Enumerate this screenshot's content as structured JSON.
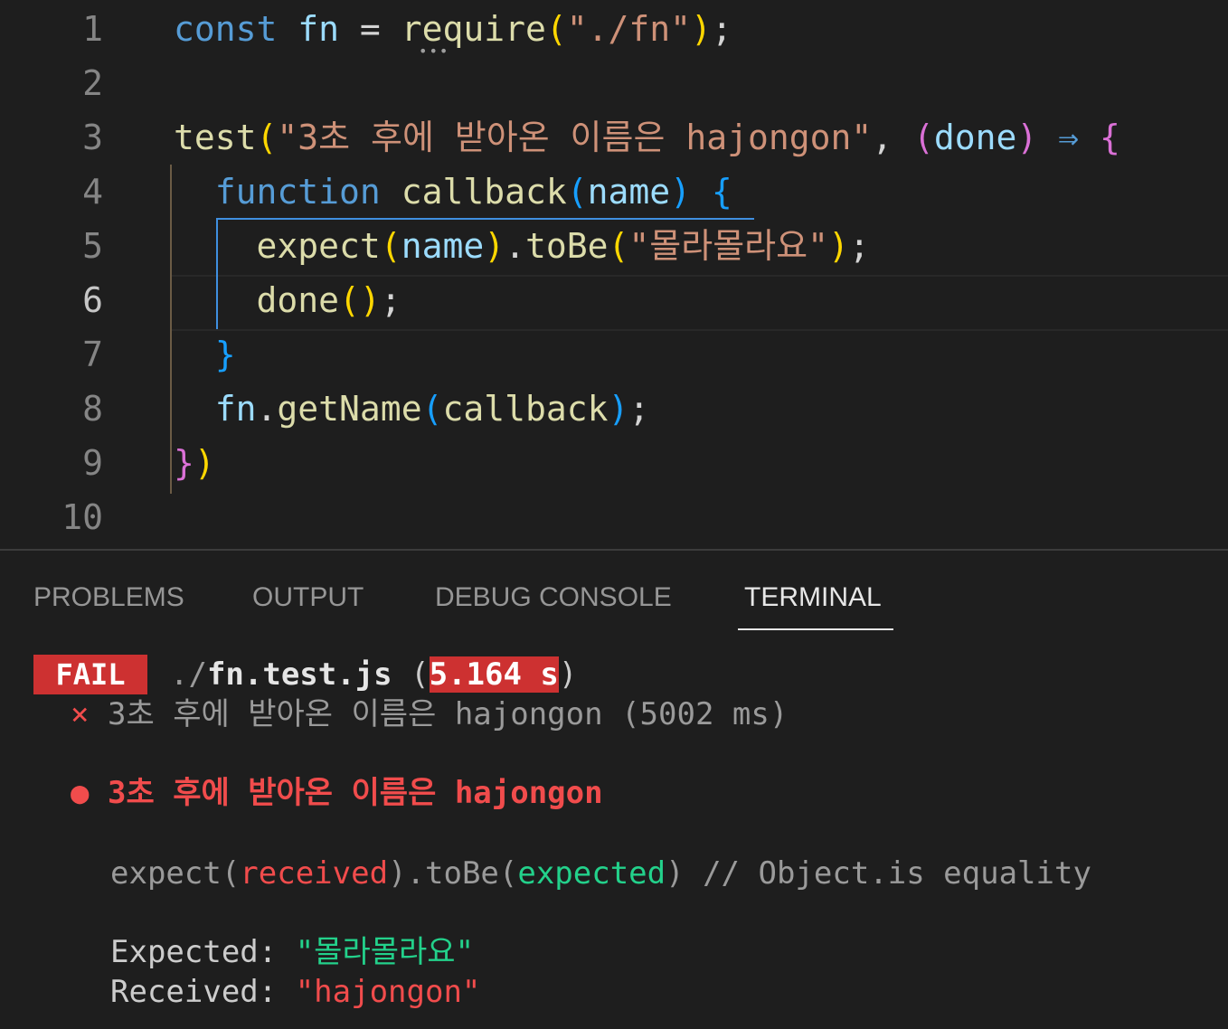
{
  "editor": {
    "active_line": "6",
    "lines": [
      {
        "num": "1",
        "tokens": [
          [
            "kw",
            "const"
          ],
          [
            "op",
            " "
          ],
          [
            "var",
            "fn"
          ],
          [
            "op",
            " = "
          ],
          [
            "fn",
            "require"
          ],
          [
            "p1",
            "("
          ],
          [
            "str",
            "\"./fn\""
          ],
          [
            "p1",
            ")"
          ],
          [
            "op",
            ";"
          ]
        ]
      },
      {
        "num": "2",
        "tokens": []
      },
      {
        "num": "3",
        "tokens": [
          [
            "fn",
            "test"
          ],
          [
            "p1",
            "("
          ],
          [
            "str",
            "\"3초 후에 받아온 이름은 hajongon\""
          ],
          [
            "op",
            ", "
          ],
          [
            "p2",
            "("
          ],
          [
            "var",
            "done"
          ],
          [
            "p2",
            ")"
          ],
          [
            "op",
            " "
          ],
          [
            "kw",
            "⇒"
          ],
          [
            "op",
            " "
          ],
          [
            "p2",
            "{"
          ]
        ]
      },
      {
        "num": "4",
        "tokens": [
          [
            "op",
            "  "
          ],
          [
            "kw",
            "function"
          ],
          [
            "op",
            " "
          ],
          [
            "fn",
            "callback"
          ],
          [
            "p3",
            "("
          ],
          [
            "var",
            "name"
          ],
          [
            "p3",
            ")"
          ],
          [
            "op",
            " "
          ],
          [
            "p3",
            "{"
          ]
        ]
      },
      {
        "num": "5",
        "tokens": [
          [
            "op",
            "    "
          ],
          [
            "fn",
            "expect"
          ],
          [
            "p1",
            "("
          ],
          [
            "var",
            "name"
          ],
          [
            "p1",
            ")"
          ],
          [
            "op",
            "."
          ],
          [
            "fn",
            "toBe"
          ],
          [
            "p1",
            "("
          ],
          [
            "str",
            "\"몰라몰라요\""
          ],
          [
            "p1",
            ")"
          ],
          [
            "op",
            ";"
          ]
        ]
      },
      {
        "num": "6",
        "tokens": [
          [
            "op",
            "    "
          ],
          [
            "fn",
            "done"
          ],
          [
            "p1",
            "()"
          ],
          [
            "op",
            ";"
          ]
        ]
      },
      {
        "num": "7",
        "tokens": [
          [
            "op",
            "  "
          ],
          [
            "p3",
            "}"
          ]
        ]
      },
      {
        "num": "8",
        "tokens": [
          [
            "op",
            "  "
          ],
          [
            "var",
            "fn"
          ],
          [
            "op",
            "."
          ],
          [
            "fn",
            "getName"
          ],
          [
            "p3",
            "("
          ],
          [
            "fn",
            "callback"
          ],
          [
            "p3",
            ")"
          ],
          [
            "op",
            ";"
          ]
        ]
      },
      {
        "num": "9",
        "tokens": [
          [
            "p2",
            "}"
          ],
          [
            "p1",
            ")"
          ]
        ]
      },
      {
        "num": "10",
        "tokens": []
      }
    ],
    "squiggle": "•••"
  },
  "panel": {
    "tabs": [
      {
        "label": "PROBLEMS",
        "active": false
      },
      {
        "label": "OUTPUT",
        "active": false
      },
      {
        "label": "DEBUG CONSOLE",
        "active": false
      },
      {
        "label": "TERMINAL",
        "active": true
      }
    ]
  },
  "terminal": {
    "fail_badge": "FAIL",
    "file_prefix": "./",
    "file_name": "fn.test.js",
    "duration_open": " (",
    "duration": "5.164 s",
    "duration_close": ")",
    "fail_mark": "×",
    "test_line": "3초 후에 받아온 이름은 hajongon (5002 ms)",
    "bullet": "●",
    "test_title": "3초 후에 받아온 이름은 hajongon",
    "matcher": {
      "expect": "expect(",
      "received": "received",
      "to_be": ").toBe(",
      "expected": "expected",
      "comment": ") // Object.is equality"
    },
    "expected_label": "Expected: ",
    "expected_value": "\"몰라몰라요\"",
    "received_label": "Received: ",
    "received_value": "\"hajongon\""
  }
}
